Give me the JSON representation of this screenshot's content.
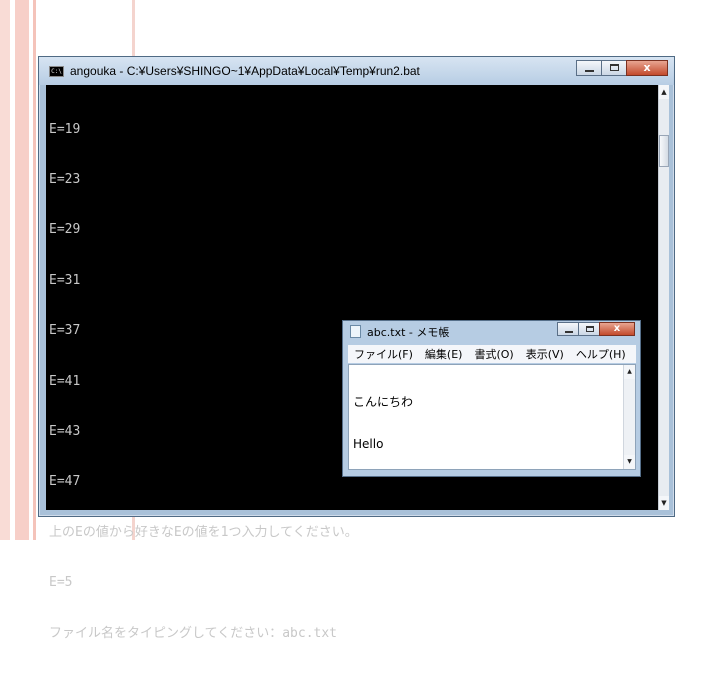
{
  "console": {
    "title": "angouka - C:¥Users¥SHINGO~1¥AppData¥Local¥Temp¥run2.bat",
    "lines": [
      "E=19",
      "E=23",
      "E=29",
      "E=31",
      "E=37",
      "E=41",
      "E=43",
      "E=47",
      "上のEの値から好きなEの値を1つ入力してください。",
      "E=5",
      "ファイル名をタイピングしてください：abc.txt"
    ]
  },
  "notepad": {
    "title": "abc.txt - メモ帳",
    "menu": [
      "ファイル(F)",
      "編集(E)",
      "書式(O)",
      "表示(V)",
      "ヘルプ(H)"
    ],
    "content": [
      "こんにちわ",
      "Hello"
    ]
  },
  "icons": {
    "close_glyph": "x",
    "up_arrow": "▲",
    "down_arrow": "▼",
    "console_icon_text": "C:\\"
  }
}
